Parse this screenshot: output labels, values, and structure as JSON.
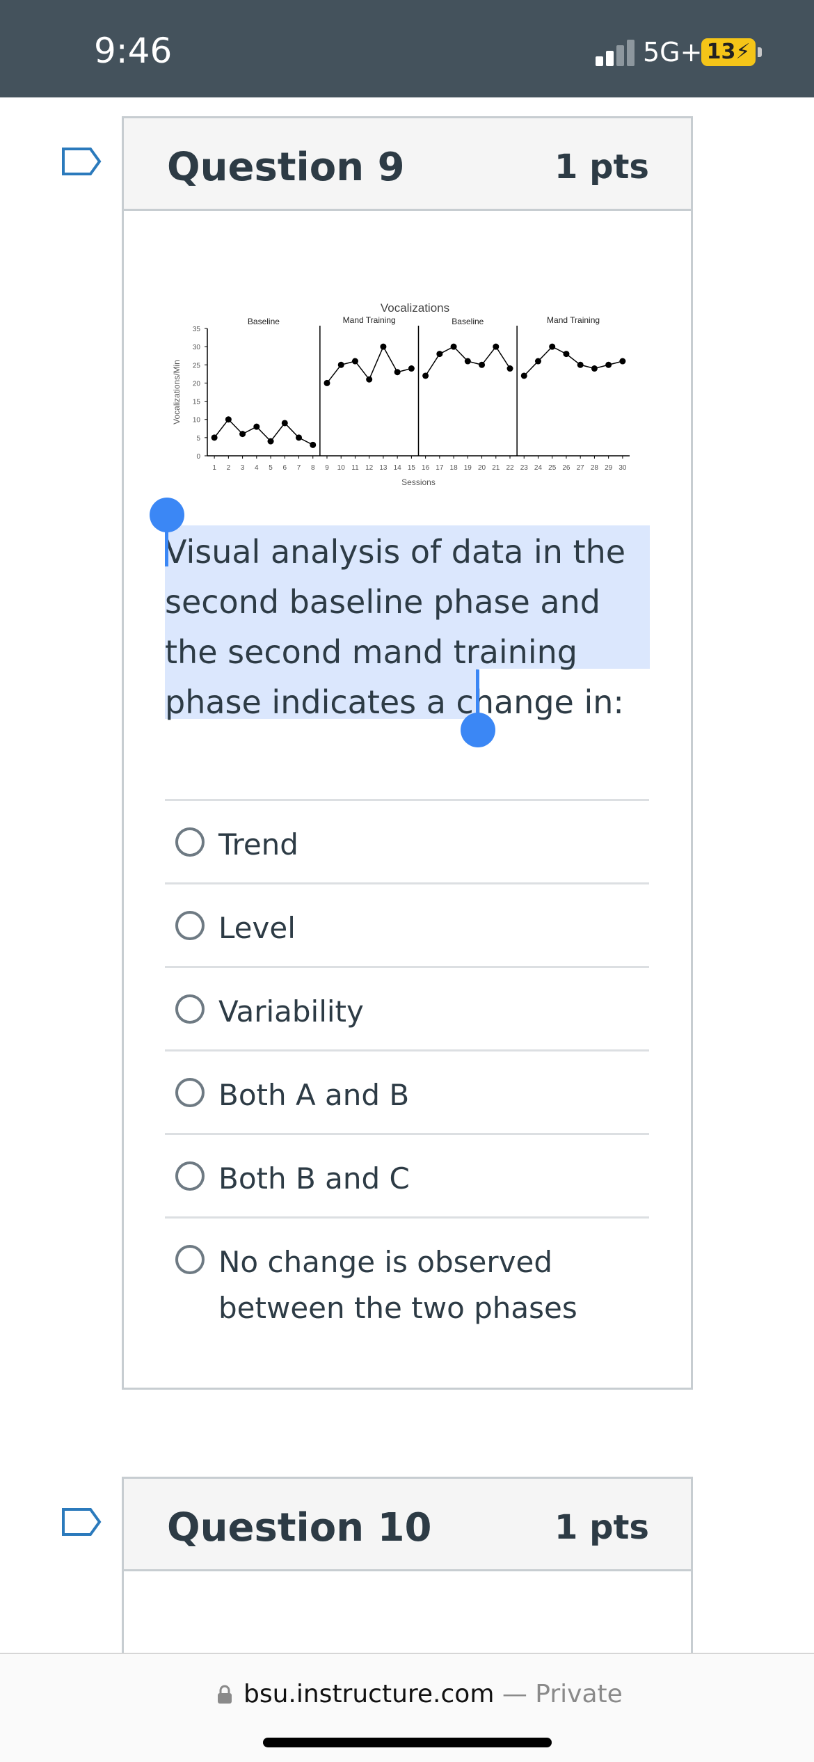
{
  "status": {
    "time": "9:46",
    "network": "5G+",
    "battery": "13"
  },
  "question9": {
    "title": "Question 9",
    "points": "1 pts",
    "prompt": "Visual analysis of data in the second baseline phase and the second mand training phase indicates a change in:",
    "options": [
      "Trend",
      "Level",
      "Variability",
      "Both A and B",
      "Both B and C",
      "No change is observed between the two phases"
    ]
  },
  "question10": {
    "title": "Question 10",
    "points": "1 pts"
  },
  "browser": {
    "domain": "bsu.instructure.com",
    "privacy": " — Private"
  },
  "colors": {
    "status_bar": "#44525c",
    "selection": "#dbe7fd",
    "handle": "#3b87f5",
    "battery": "#f5c518",
    "flag_outline": "#2b7abc"
  },
  "icons": {
    "flag": "flag-outline-icon",
    "lock": "lock-icon",
    "signal": "signal-bars-icon",
    "battery": "battery-charging-icon"
  },
  "chart_data": {
    "type": "line",
    "title": "Vocalizations",
    "xlabel": "Sessions",
    "ylabel": "Vocalizations/Min",
    "ylim": [
      0,
      35
    ],
    "yticks": [
      0,
      5,
      10,
      15,
      20,
      25,
      30,
      35
    ],
    "xticks": [
      1,
      2,
      3,
      4,
      5,
      6,
      7,
      8,
      9,
      10,
      11,
      12,
      13,
      14,
      15,
      16,
      17,
      18,
      19,
      20,
      21,
      22,
      23,
      24,
      25,
      26,
      27,
      28,
      29,
      30
    ],
    "grid": false,
    "phases": [
      {
        "label": "Baseline",
        "start": 1,
        "end": 8
      },
      {
        "label": "Mand Training",
        "start": 9,
        "end": 15
      },
      {
        "label": "Baseline",
        "start": 16,
        "end": 22
      },
      {
        "label": "Mand Training",
        "start": 23,
        "end": 30
      }
    ],
    "phase_lines": [
      8.5,
      15.5,
      22.5
    ],
    "series": [
      {
        "x": [
          1,
          2,
          3,
          4,
          5,
          6,
          7,
          8
        ],
        "values": [
          5,
          10,
          6,
          8,
          4,
          9,
          5,
          3
        ]
      },
      {
        "x": [
          9,
          10,
          11,
          12,
          13,
          14,
          15
        ],
        "values": [
          20,
          25,
          26,
          21,
          30,
          23,
          24
        ]
      },
      {
        "x": [
          16,
          17,
          18,
          19,
          20,
          21,
          22
        ],
        "values": [
          22,
          28,
          30,
          26,
          25,
          30,
          24
        ]
      },
      {
        "x": [
          23,
          24,
          25,
          26,
          27,
          28,
          29,
          30
        ],
        "values": [
          22,
          26,
          30,
          28,
          25,
          24,
          25,
          26
        ]
      }
    ]
  }
}
